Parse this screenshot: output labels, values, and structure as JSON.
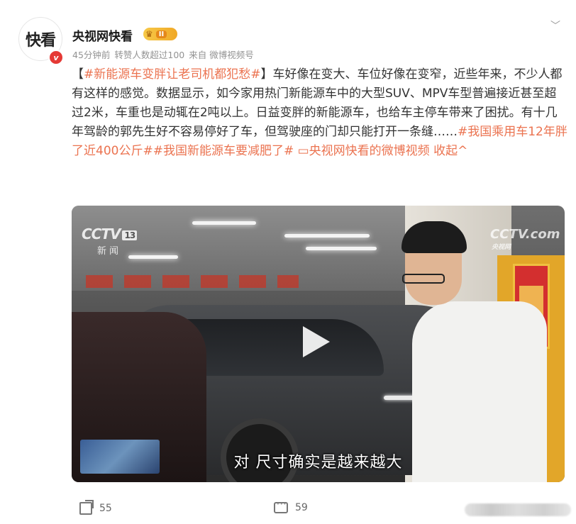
{
  "author": {
    "avatar_text": "快看",
    "verified_mark": "v",
    "name": "央视网快看",
    "level": "II"
  },
  "meta": {
    "time": "45分钟前",
    "reposts_note": "转赞人数超过100",
    "source": "来自 微博视频号"
  },
  "post": {
    "bracket_open": "【",
    "topic1": "#新能源车变胖让老司机都犯愁#",
    "bracket_close": "】",
    "body": "车好像在变大、车位好像在变窄，近些年来，不少人都有这样的感觉。数据显示，如今家用热门新能源车中的大型SUV、MPV车型普遍接近甚至超过2米，车重也是动辄在2吨以上。日益变胖的新能源车，也给车主停车带来了困扰。有十几年驾龄的郭先生好不容易停好了车，但驾驶座的门却只能打开一条缝……",
    "topic2": "#我国乘用车12年胖了近400公斤#",
    "topic3": "#我国新能源车要减肥了#",
    "video_link": "▭央视网快看的微博视频",
    "collapse": "收起^"
  },
  "video": {
    "logo_left": "CCTV",
    "logo_left_channel": "13",
    "logo_left_sub": "新闻",
    "logo_right": "CCTV.com",
    "logo_right_small": "央视网",
    "subtitle": "对 尺寸确实是越来越大"
  },
  "footer": {
    "share_count": "55",
    "comment_count": "59"
  },
  "icons": {
    "more": "chevron-down-icon",
    "share": "share-icon",
    "comment": "comment-icon",
    "play": "play-icon",
    "crown": "crown-icon"
  },
  "colors": {
    "link": "#eb7350",
    "verified": "#e53935",
    "badge": "#f0a826"
  }
}
